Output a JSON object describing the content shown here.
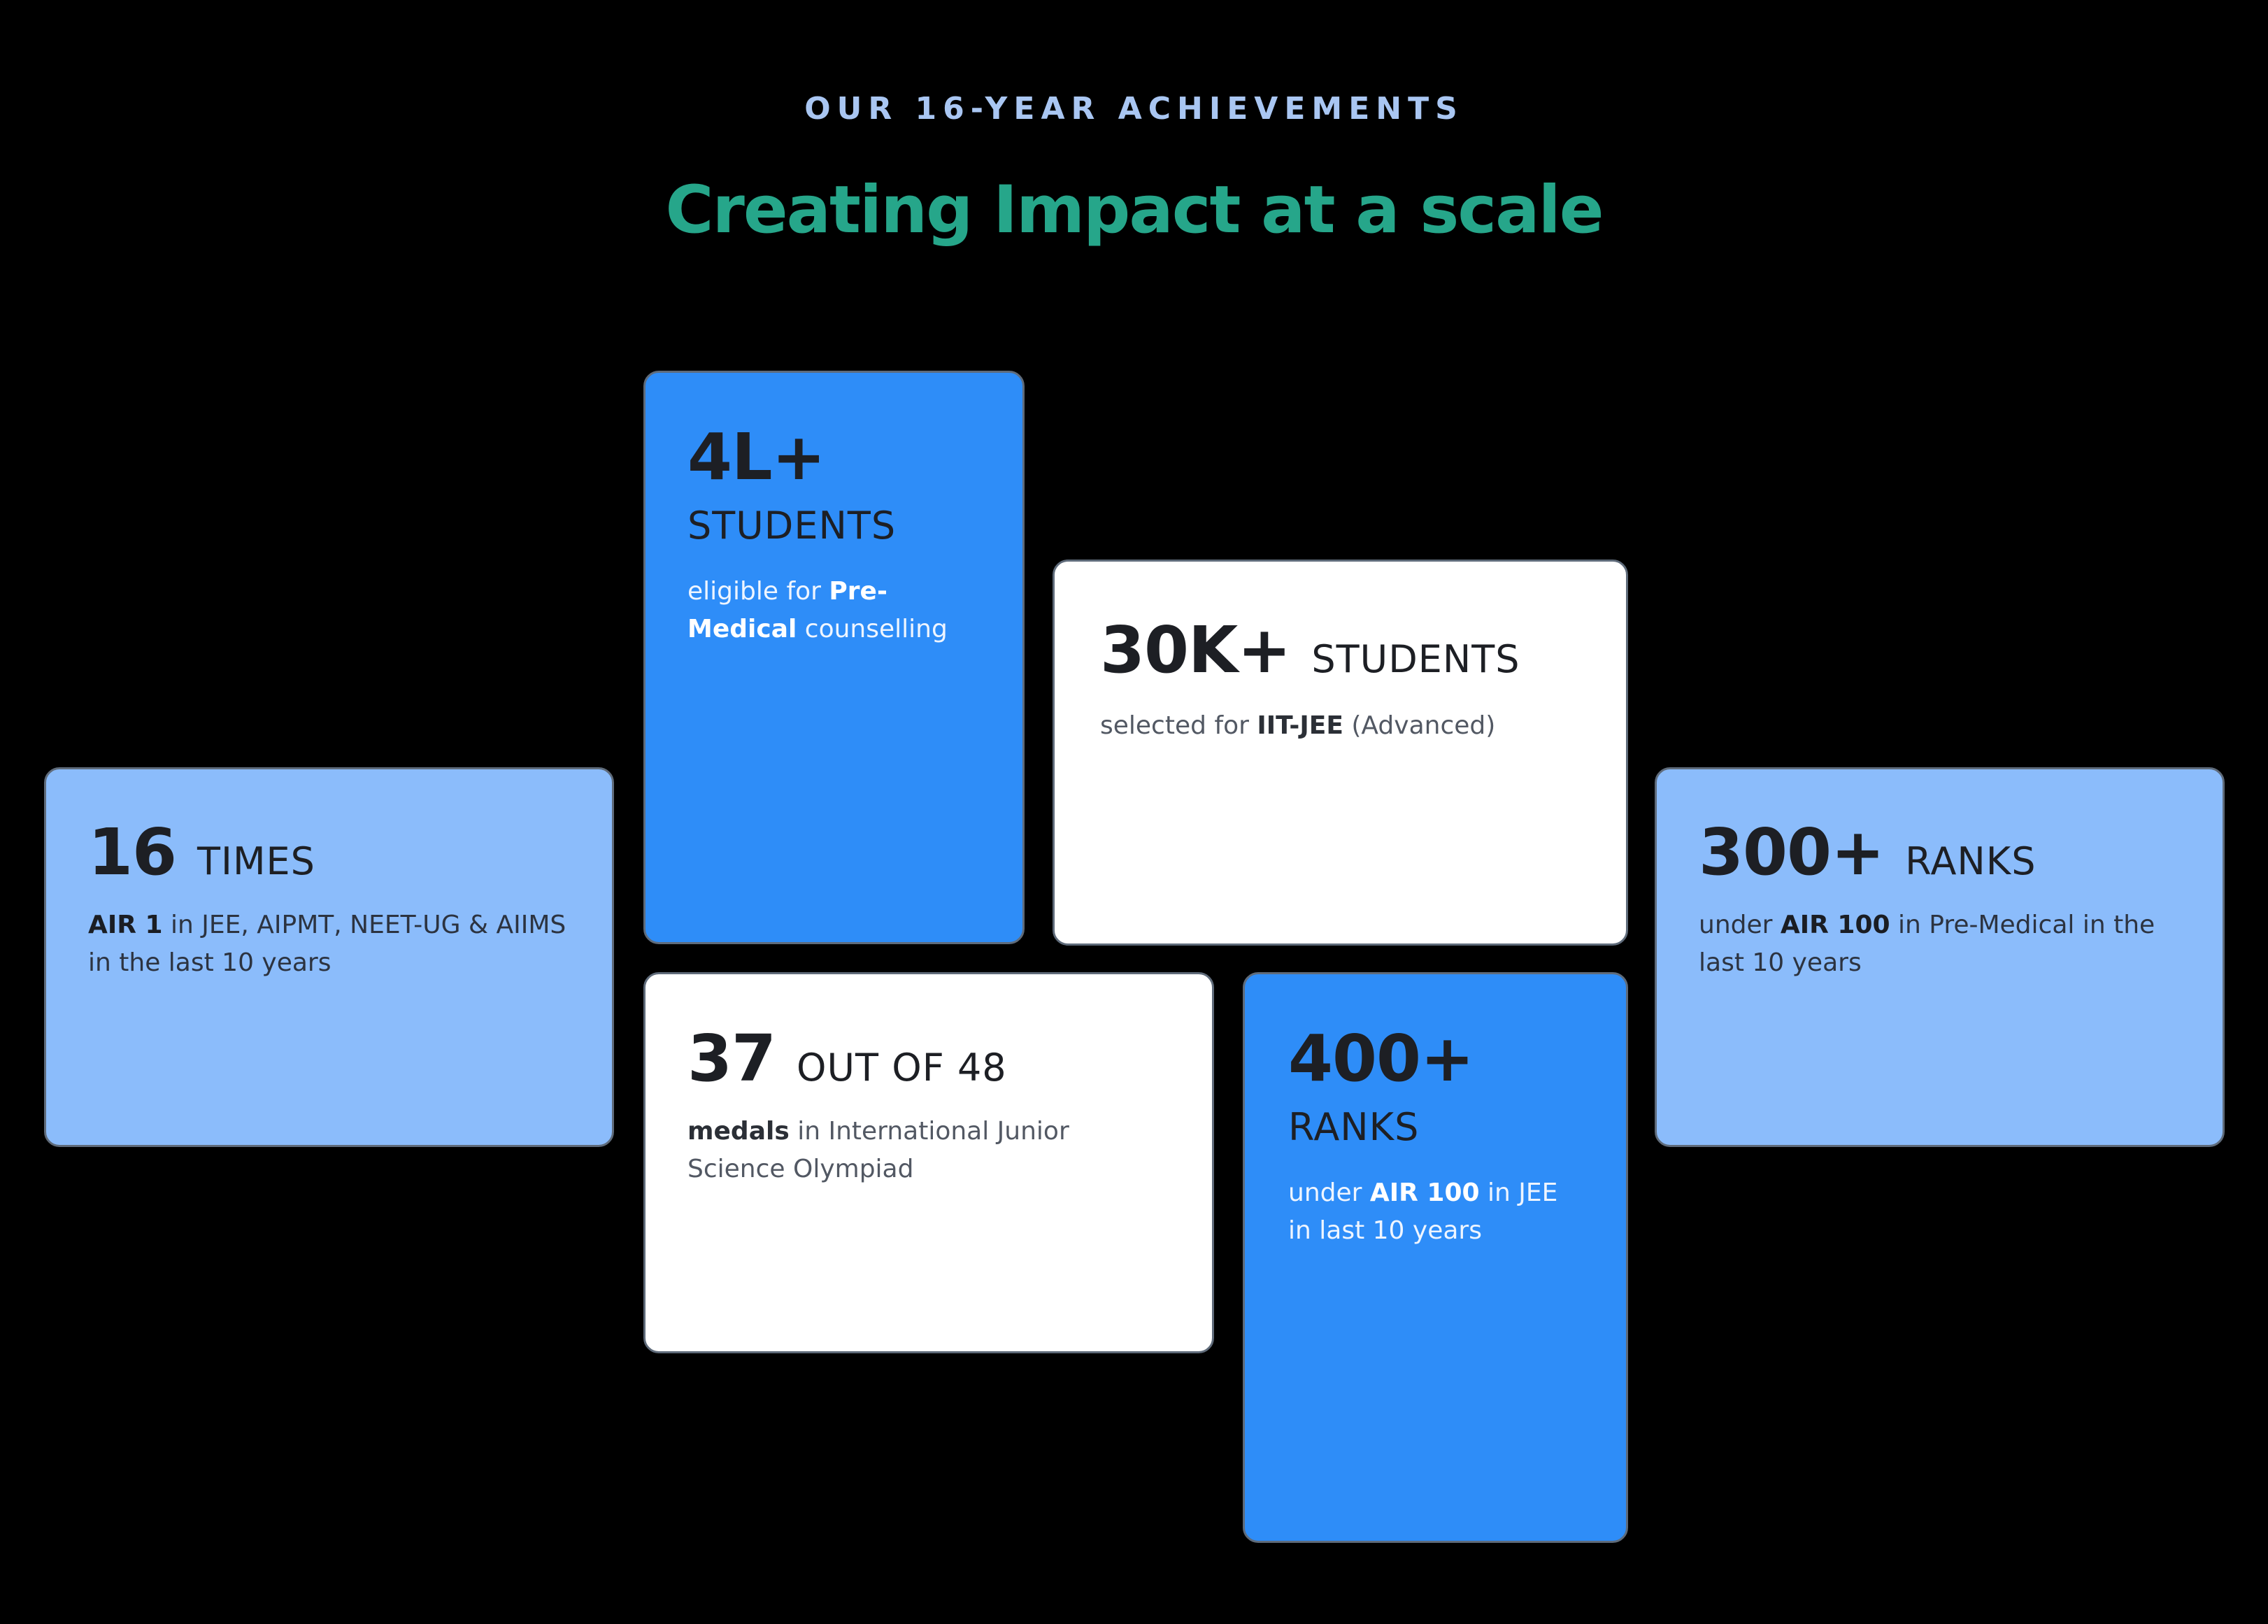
{
  "header": {
    "eyebrow": "OUR 16-YEAR ACHIEVEMENTS",
    "headline": "Creating Impact at a scale"
  },
  "cards": {
    "students_4l": {
      "value": "4L+",
      "unit": "STUDENTS",
      "desc_part1": "eligible for ",
      "desc_bold": "Pre-Medical",
      "desc_part2": " counselling"
    },
    "students_30k": {
      "value": "30K+",
      "unit": "STUDENTS",
      "desc_part1": "selected for ",
      "desc_bold": "IIT-JEE",
      "desc_part2": " (Advanced)"
    },
    "times_16": {
      "value": "16",
      "unit": "TIMES",
      "desc_bold": "AIR 1",
      "desc_part2": " in JEE, AIPMT, NEET-UG & AIIMS in the last 10 years"
    },
    "ranks_300": {
      "value": "300+",
      "unit": "RANKS",
      "desc_part1": "under ",
      "desc_bold": "AIR 100",
      "desc_part2": " in Pre-Medical in the last 10 years"
    },
    "medals_37": {
      "value": "37",
      "unit": "OUT OF 48",
      "desc_bold": "medals",
      "desc_part2": " in International Junior Science Olympiad"
    },
    "ranks_400": {
      "value": "400+",
      "unit": "RANKS",
      "desc_part1": "under ",
      "desc_bold": "AIR 100",
      "desc_part2": " in JEE in last 10 years"
    }
  },
  "colors": {
    "background": "#000000",
    "eyebrow": "#a9c6f2",
    "headline": "#26a68a",
    "card_blue": "#2e8df8",
    "card_light_blue": "#8bbcfb",
    "card_white": "#ffffff"
  }
}
